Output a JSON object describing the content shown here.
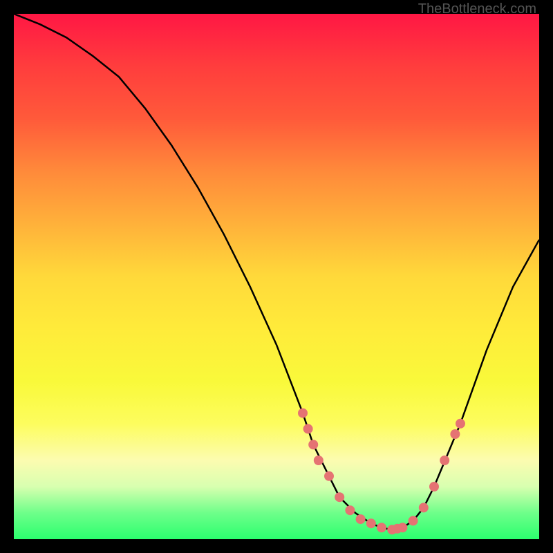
{
  "watermark": "TheBottleneck.com",
  "chart_data": {
    "type": "line",
    "title": "",
    "xlabel": "",
    "ylabel": "",
    "xlim": [
      0,
      100
    ],
    "ylim": [
      0,
      100
    ],
    "grid": false,
    "x": [
      0,
      5,
      10,
      15,
      20,
      25,
      30,
      35,
      40,
      45,
      50,
      55,
      57,
      60,
      62,
      65,
      68,
      70,
      72,
      74,
      76,
      78,
      80,
      85,
      90,
      95,
      100
    ],
    "values": [
      100,
      98,
      95.5,
      92,
      88,
      82,
      75,
      67,
      58,
      48,
      37,
      24,
      18,
      12,
      8,
      5,
      3,
      2.2,
      1.8,
      2.2,
      3.5,
      6,
      10,
      22,
      36,
      48,
      57
    ],
    "markers": [
      {
        "x": 55,
        "y": 24
      },
      {
        "x": 56,
        "y": 21
      },
      {
        "x": 57,
        "y": 18
      },
      {
        "x": 58,
        "y": 15
      },
      {
        "x": 60,
        "y": 12
      },
      {
        "x": 62,
        "y": 8
      },
      {
        "x": 64,
        "y": 5.5
      },
      {
        "x": 66,
        "y": 3.8
      },
      {
        "x": 68,
        "y": 3
      },
      {
        "x": 70,
        "y": 2.2
      },
      {
        "x": 72,
        "y": 1.8
      },
      {
        "x": 73,
        "y": 2.0
      },
      {
        "x": 74,
        "y": 2.2
      },
      {
        "x": 76,
        "y": 3.5
      },
      {
        "x": 78,
        "y": 6
      },
      {
        "x": 80,
        "y": 10
      },
      {
        "x": 82,
        "y": 15
      },
      {
        "x": 84,
        "y": 20
      },
      {
        "x": 85,
        "y": 22
      }
    ],
    "marker_color": "#e57373",
    "line_color": "#000000"
  }
}
